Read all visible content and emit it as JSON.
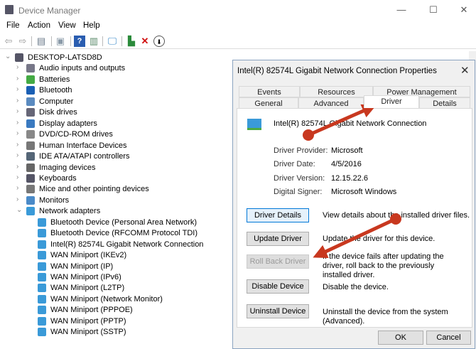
{
  "window": {
    "title": "Device Manager",
    "minimize": "—",
    "maximize": "☐",
    "close": "✕"
  },
  "menu": [
    "File",
    "Action",
    "View",
    "Help"
  ],
  "toolbar": {
    "icons": [
      "back-icon",
      "forward-icon",
      "properties-icon",
      "update-icon",
      "help-icon",
      "show-hidden-icon",
      "scan-hardware-icon",
      "add-driver-icon",
      "uninstall-icon",
      "disable-icon"
    ]
  },
  "tree": {
    "root": "DESKTOP-LATSD8D",
    "categories": [
      "Audio inputs and outputs",
      "Batteries",
      "Bluetooth",
      "Computer",
      "Disk drives",
      "Display adapters",
      "DVD/CD-ROM drives",
      "Human Interface Devices",
      "IDE ATA/ATAPI controllers",
      "Imaging devices",
      "Keyboards",
      "Mice and other pointing devices",
      "Monitors",
      "Network adapters"
    ],
    "network_children": [
      "Bluetooth Device (Personal Area Network)",
      "Bluetooth Device (RFCOMM Protocol TDI)",
      "Intel(R) 82574L Gigabit Network Connection",
      "WAN Miniport (IKEv2)",
      "WAN Miniport (IP)",
      "WAN Miniport (IPv6)",
      "WAN Miniport (L2TP)",
      "WAN Miniport (Network Monitor)",
      "WAN Miniport (PPPOE)",
      "WAN Miniport (PPTP)",
      "WAN Miniport (SSTP)"
    ]
  },
  "dialog": {
    "title": "Intel(R) 82574L Gigabit Network Connection Properties",
    "close": "✕",
    "tabs_row1": [
      "Events",
      "Resources",
      "Power Management"
    ],
    "tabs_row2": [
      "General",
      "Advanced",
      "Driver",
      "Details"
    ],
    "device_name": "Intel(R) 82574L Gigabit Network Connection",
    "info": [
      {
        "label": "Driver Provider:",
        "value": "Microsoft"
      },
      {
        "label": "Driver Date:",
        "value": "4/5/2016"
      },
      {
        "label": "Driver Version:",
        "value": "12.15.22.6"
      },
      {
        "label": "Digital Signer:",
        "value": "Microsoft Windows"
      }
    ],
    "actions": [
      {
        "label": "Driver Details",
        "desc": "View details about the installed driver files."
      },
      {
        "label": "Update Driver",
        "desc": "Update the driver for this device."
      },
      {
        "label": "Roll Back Driver",
        "desc": "If the device fails after updating the driver, roll back to the previously installed driver."
      },
      {
        "label": "Disable Device",
        "desc": "Disable the device."
      },
      {
        "label": "Uninstall Device",
        "desc": "Uninstall the device from the system (Advanced)."
      }
    ],
    "ok": "OK",
    "cancel": "Cancel"
  },
  "annotation_color": "#c8381f"
}
